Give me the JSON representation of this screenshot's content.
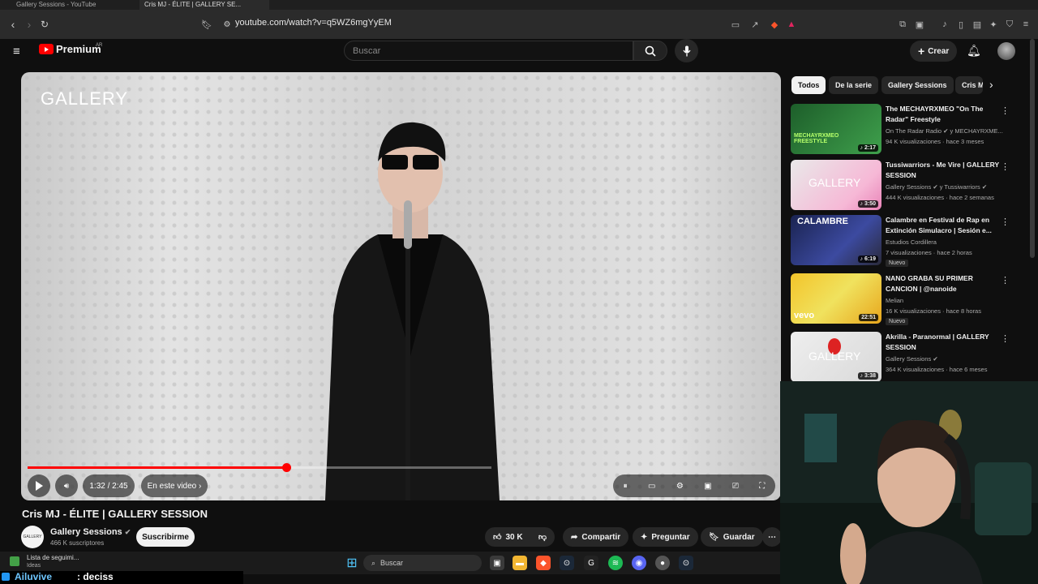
{
  "browser": {
    "tabs": [
      "Gallery Sessions - YouTube",
      "Cris MJ - ÉLITE | GALLERY SE..."
    ],
    "url": "youtube.com/watch?v=q5WZ6mgYyEM"
  },
  "header": {
    "logo_text": "Premium",
    "country": "AR",
    "search_placeholder": "Buscar",
    "create_label": "Crear"
  },
  "video": {
    "overlay_text": "GALLERY",
    "time": "1:32 / 2:45",
    "chapter_label": "En este video",
    "progress": 0.5576,
    "title": "Cris MJ - ÉLITE | GALLERY SESSION"
  },
  "channel": {
    "avatar_text": "GALLERY",
    "name": "Gallery Sessions",
    "subscribers": "466 K suscriptores",
    "subscribe_label": "Suscribirme"
  },
  "actions": {
    "likes": "30 K",
    "share": "Compartir",
    "ask": "Preguntar",
    "save": "Guardar"
  },
  "chips": [
    "Todos",
    "De la serie",
    "Gallery Sessions",
    "Cris MJ"
  ],
  "recommendations": [
    {
      "title": "The MECHAYRXMEO \"On The Radar\" Freestyle",
      "channel": "On The Radar Radio ✔ y MECHAYRXME...",
      "meta": "94 K visualizaciones · hace 3 meses",
      "duration": "2:17",
      "badge": ""
    },
    {
      "title": "Tussiwarriors - Me Vire | GALLERY SESSION",
      "channel": "Gallery Sessions ✔ y Tussiwarriors ✔",
      "meta": "444 K visualizaciones · hace 2 semanas",
      "duration": "3:50",
      "badge": ""
    },
    {
      "title": "Calambre en Festival de Rap en Extinción Simulacro | Sesión e...",
      "channel": "Estudios Cordillera",
      "meta": "7 visualizaciones · hace 2 horas",
      "duration": "6:19",
      "badge": "Nuevo"
    },
    {
      "title": "NANO GRABA SU PRIMER CANCION | @nanoide",
      "channel": "Melian",
      "meta": "16 K visualizaciones · hace 8 horas",
      "duration": "22:51",
      "badge": "Nuevo"
    },
    {
      "title": "Akrilla - Paranormal | GALLERY SESSION",
      "channel": "Gallery Sessions ✔",
      "meta": "364 K visualizaciones · hace 6 meses",
      "duration": "3:38",
      "badge": ""
    }
  ],
  "thumb_texts": [
    "MECHAYRXMEO FREESTYLE",
    "GALLERY",
    "CALAMBRE",
    "vevo",
    "GALLERY"
  ],
  "taskbar": {
    "weather_title": "Lista de seguimi...",
    "weather_sub": "Ideas",
    "search_label": "Buscar"
  },
  "chat": {
    "user": "Ailuvive",
    "message": ": deciss"
  }
}
